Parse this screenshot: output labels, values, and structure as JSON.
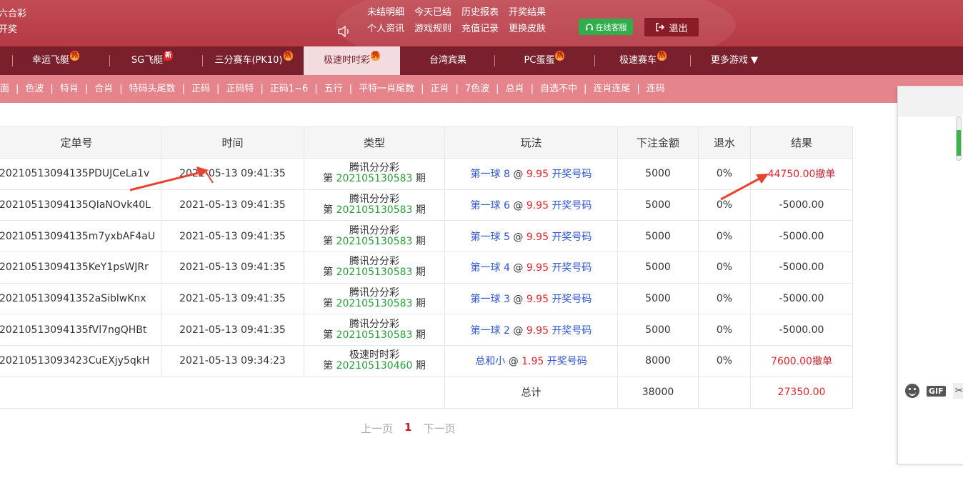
{
  "header": {
    "brand_line1": "六合彩",
    "brand_line2": "开奖",
    "links_row1": [
      "未结明细",
      "今天已结",
      "历史报表",
      "开奖结果"
    ],
    "links_row2": [
      "个人资讯",
      "游戏规则",
      "充值记录",
      "更换皮肤"
    ],
    "customer_service": "在线客服",
    "logout": "退出"
  },
  "game_tabs": [
    {
      "label": "幸运飞艇",
      "badge": "热",
      "badge_type": "hot"
    },
    {
      "label": "SG飞艇",
      "badge": "新",
      "badge_type": "new"
    },
    {
      "label": "三分赛车(PK10)",
      "badge": "热",
      "badge_type": "hot"
    },
    {
      "label": "极速时时彩",
      "badge": "热",
      "badge_type": "hot",
      "active": true
    },
    {
      "label": "台湾宾果",
      "badge": "",
      "badge_type": ""
    },
    {
      "label": "PC蛋蛋",
      "badge": "热",
      "badge_type": "hot"
    },
    {
      "label": "极速赛车",
      "badge": "热",
      "badge_type": "hot"
    },
    {
      "label": "更多游戏 ▼",
      "badge": "",
      "badge_type": ""
    }
  ],
  "sub_tabs": [
    "两面",
    "色波",
    "特肖",
    "合肖",
    "特码头尾数",
    "正码",
    "正码特",
    "正码1~6",
    "五行",
    "平特一肖尾数",
    "正肖",
    "7色波",
    "总肖",
    "自选不中",
    "连肖连尾",
    "连码"
  ],
  "table": {
    "headers": [
      "定单号",
      "时间",
      "类型",
      "玩法",
      "下注金额",
      "退水",
      "结果"
    ],
    "issue_prefix": "第",
    "issue_suffix": "期",
    "at": "@",
    "draw_link": "开奖号码",
    "cancel": "撤单",
    "rows": [
      {
        "order": "20210513094135PDUJCeLa1v",
        "time": "2021-05-13 09:41:35",
        "type": "腾讯分分彩",
        "issue": "202105130583",
        "play": "第一球 8",
        "odds": "9.95",
        "amount": "5000",
        "rebate": "0%",
        "result": "44750.00",
        "result_color": "red",
        "cancellable": true
      },
      {
        "order": "20210513094135QIaNOvk40L",
        "time": "2021-05-13 09:41:35",
        "type": "腾讯分分彩",
        "issue": "202105130583",
        "play": "第一球 6",
        "odds": "9.95",
        "amount": "5000",
        "rebate": "0%",
        "result": "-5000.00",
        "result_color": "normal",
        "cancellable": false
      },
      {
        "order": "20210513094135m7yxbAF4aU",
        "time": "2021-05-13 09:41:35",
        "type": "腾讯分分彩",
        "issue": "202105130583",
        "play": "第一球 5",
        "odds": "9.95",
        "amount": "5000",
        "rebate": "0%",
        "result": "-5000.00",
        "result_color": "normal",
        "cancellable": false
      },
      {
        "order": "20210513094135KeY1psWJRr",
        "time": "2021-05-13 09:41:35",
        "type": "腾讯分分彩",
        "issue": "202105130583",
        "play": "第一球 4",
        "odds": "9.95",
        "amount": "5000",
        "rebate": "0%",
        "result": "-5000.00",
        "result_color": "normal",
        "cancellable": false
      },
      {
        "order": "202105130941352aSiblwKnx",
        "time": "2021-05-13 09:41:35",
        "type": "腾讯分分彩",
        "issue": "202105130583",
        "play": "第一球 3",
        "odds": "9.95",
        "amount": "5000",
        "rebate": "0%",
        "result": "-5000.00",
        "result_color": "normal",
        "cancellable": false
      },
      {
        "order": "20210513094135fVl7ngQHBt",
        "time": "2021-05-13 09:41:35",
        "type": "腾讯分分彩",
        "issue": "202105130583",
        "play": "第一球 2",
        "odds": "9.95",
        "amount": "5000",
        "rebate": "0%",
        "result": "-5000.00",
        "result_color": "normal",
        "cancellable": false
      },
      {
        "order": "20210513093423CuEXjy5qkH",
        "time": "2021-05-13 09:34:23",
        "type": "极速时时彩",
        "issue": "202105130460",
        "play": "总和小",
        "odds": "1.95",
        "amount": "8000",
        "rebate": "0%",
        "result": "7600.00",
        "result_color": "red",
        "cancellable": true
      }
    ],
    "total_label": "总计",
    "total_amount": "38000",
    "total_result": "27350.00"
  },
  "pager": {
    "prev": "上一页",
    "current": "1",
    "next": "下一页"
  },
  "chat": {
    "gif": "GIF"
  },
  "colors": {
    "header": "#b63a45",
    "nav": "#7a1f2c",
    "subnav": "#e6848b",
    "link_blue": "#2d55d6",
    "odds_red": "#e0262c",
    "issue_green": "#2a9d3a",
    "arrow": "#e8432f"
  }
}
